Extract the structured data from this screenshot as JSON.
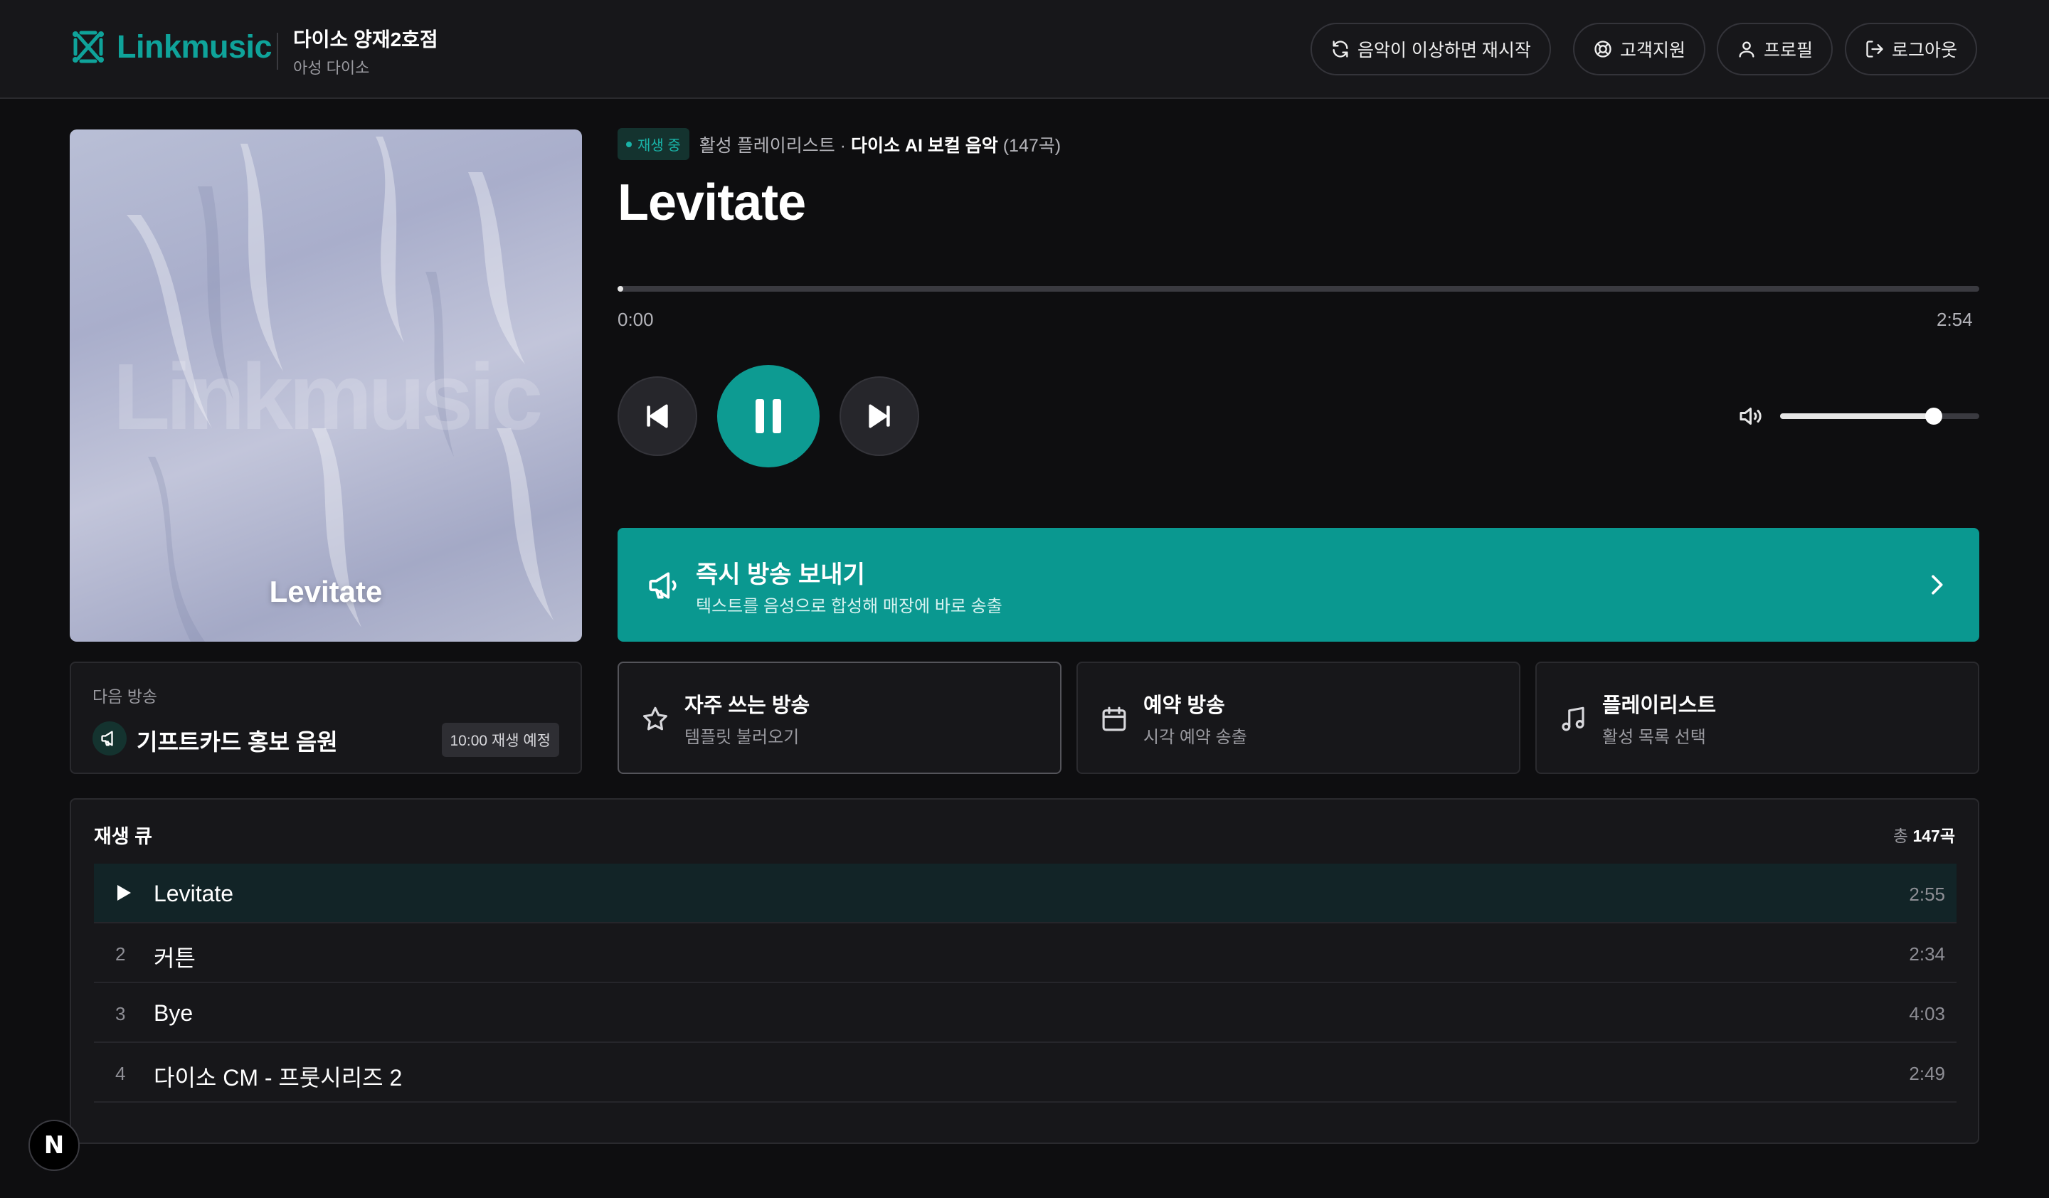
{
  "brand": {
    "name": "Linkmusic",
    "accent": "#0fa39a"
  },
  "store": {
    "name": "다이소 양재2호점",
    "subtitle": "아성 다이소"
  },
  "header_buttons": {
    "restart": "음악이 이상하면 재시작",
    "support": "고객지원",
    "profile": "프로필",
    "logout": "로그아웃"
  },
  "album": {
    "watermark": "Linkmusic",
    "title": "Levitate"
  },
  "now_playing": {
    "badge": "재생 중",
    "playlist_prefix": "활성 플레이리스트 · ",
    "playlist_name": "다이소 AI 보컬 음악",
    "playlist_count": "(147곡)",
    "title": "Levitate",
    "time_current": "0:00",
    "time_total": "2:54",
    "progress": 0.003,
    "volume": 0.77,
    "state": "playing"
  },
  "broadcast": {
    "title": "즉시 방송 보내기",
    "subtitle": "텍스트를 음성으로 합성해 매장에 바로 송출"
  },
  "next_broadcast": {
    "label": "다음 방송",
    "title": "기프트카드 홍보 음원",
    "time": "10:00 재생 예정"
  },
  "cards": [
    {
      "title": "자주 쓰는 방송",
      "subtitle": "템플릿 불러오기",
      "icon": "star-icon"
    },
    {
      "title": "예약 방송",
      "subtitle": "시각 예약 송출",
      "icon": "calendar-icon"
    },
    {
      "title": "플레이리스트",
      "subtitle": "활성 목록 선택",
      "icon": "music-note-icon"
    }
  ],
  "queue": {
    "title": "재생 큐",
    "total_prefix": "총 ",
    "total_count": "147곡",
    "rows": [
      {
        "index": "",
        "title": "Levitate",
        "duration": "2:55",
        "current": true
      },
      {
        "index": "2",
        "title": "커튼",
        "duration": "2:34",
        "current": false
      },
      {
        "index": "3",
        "title": "Bye",
        "duration": "4:03",
        "current": false
      },
      {
        "index": "4",
        "title": "다이소 CM - 프룻시리즈 2",
        "duration": "2:49",
        "current": false
      }
    ]
  },
  "dev_badge": "N"
}
